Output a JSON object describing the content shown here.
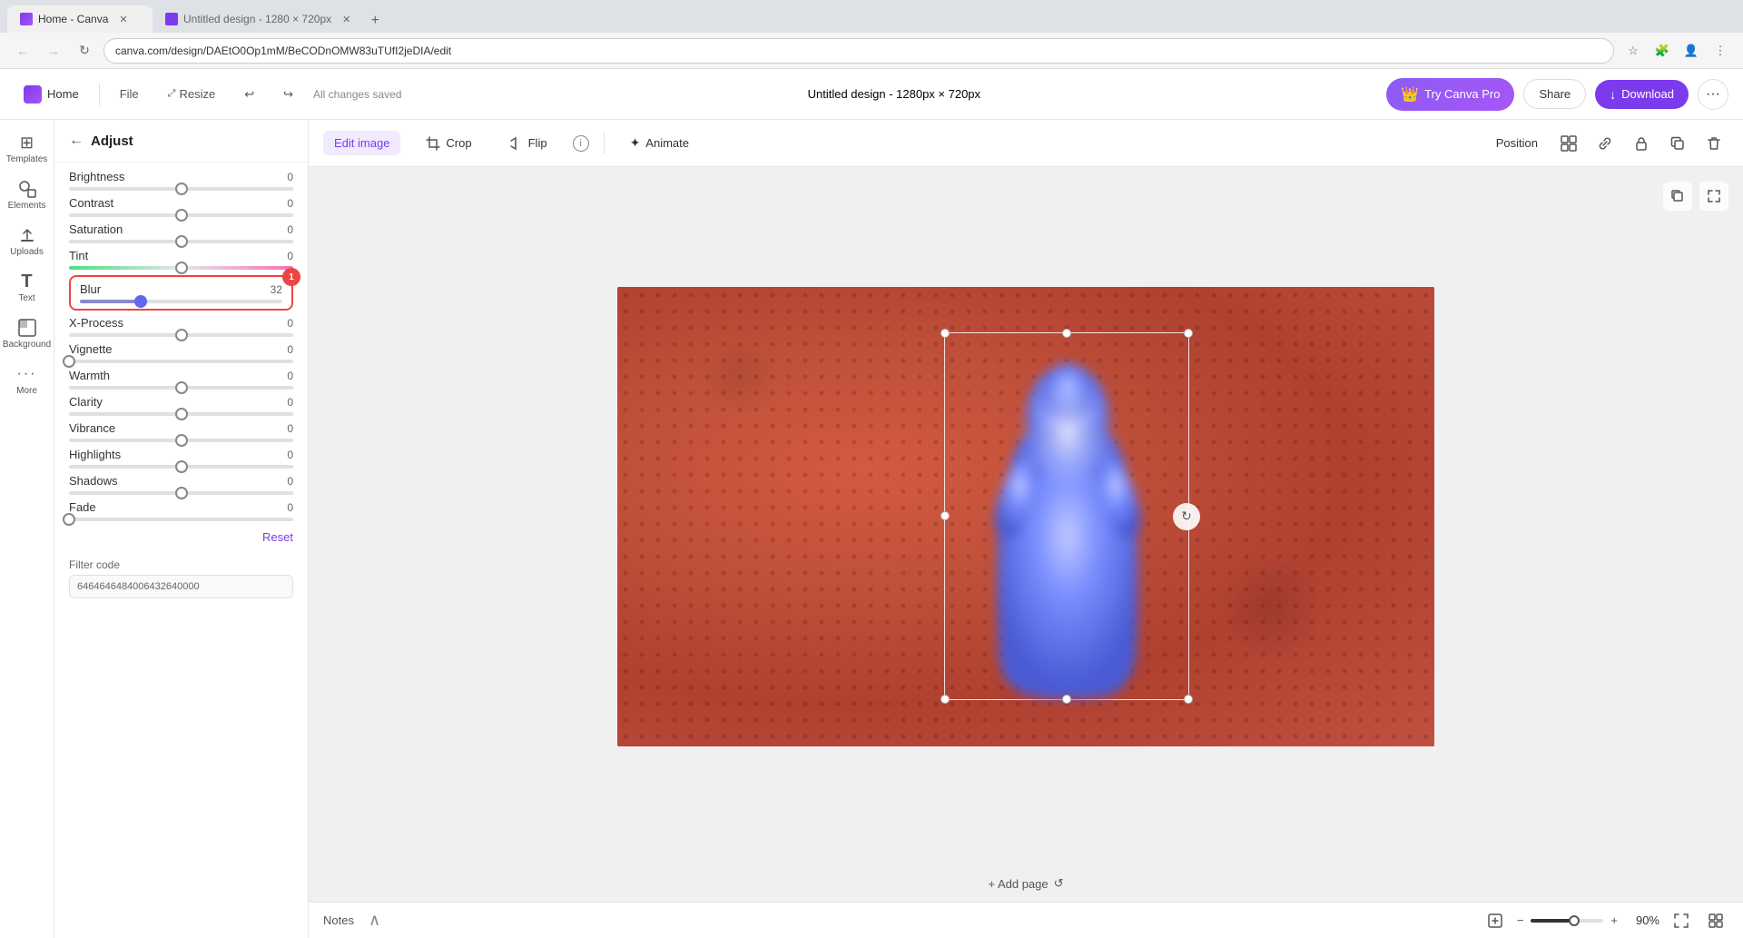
{
  "browser": {
    "tabs": [
      {
        "id": "home",
        "label": "Home - Canva",
        "active": true,
        "icon": "canva"
      },
      {
        "id": "design",
        "label": "Untitled design - 1280 × 720px",
        "active": false,
        "icon": "canva"
      }
    ],
    "address": "canva.com/design/DAEtO0Op1mM/BeCODnOMW83uTUfI2jeDIA/edit"
  },
  "topbar": {
    "home_label": "Home",
    "file_label": "File",
    "resize_label": "Resize",
    "save_status": "All changes saved",
    "design_title": "Untitled design - 1280px × 720px",
    "try_pro_label": "Try Canva Pro",
    "share_label": "Share",
    "download_label": "Download"
  },
  "sidebar_icons": [
    {
      "id": "templates",
      "label": "Templates",
      "icon": "⊞"
    },
    {
      "id": "elements",
      "label": "Elements",
      "icon": "✦"
    },
    {
      "id": "uploads",
      "label": "Uploads",
      "icon": "↑"
    },
    {
      "id": "text",
      "label": "Text",
      "icon": "T"
    },
    {
      "id": "background",
      "label": "Background",
      "icon": "▨"
    },
    {
      "id": "more",
      "label": "More",
      "icon": "···"
    }
  ],
  "adjust_panel": {
    "title": "Adjust",
    "sliders": [
      {
        "id": "brightness",
        "label": "Brightness",
        "value": 0,
        "percent": 50
      },
      {
        "id": "contrast",
        "label": "Contrast",
        "value": 0,
        "percent": 50
      },
      {
        "id": "saturation",
        "label": "Saturation",
        "value": 0,
        "percent": 50
      },
      {
        "id": "tint",
        "label": "Tint",
        "value": 0,
        "percent": 50,
        "special": "tint"
      },
      {
        "id": "blur",
        "label": "Blur",
        "value": 32,
        "percent": 30,
        "highlighted": true
      },
      {
        "id": "xprocess",
        "label": "X-Process",
        "value": 0,
        "percent": 50
      },
      {
        "id": "vignette",
        "label": "Vignette",
        "value": 0,
        "percent": 0
      },
      {
        "id": "warmth",
        "label": "Warmth",
        "value": 0,
        "percent": 50
      },
      {
        "id": "clarity",
        "label": "Clarity",
        "value": 0,
        "percent": 50
      },
      {
        "id": "vibrance",
        "label": "Vibrance",
        "value": 0,
        "percent": 50
      },
      {
        "id": "highlights",
        "label": "Highlights",
        "value": 0,
        "percent": 50
      },
      {
        "id": "shadows",
        "label": "Shadows",
        "value": 0,
        "percent": 50
      },
      {
        "id": "fade",
        "label": "Fade",
        "value": 0,
        "percent": 0
      }
    ],
    "reset_label": "Reset",
    "filter_code_label": "Filter code",
    "filter_code_value": "6464646484006432640000"
  },
  "toolbar": {
    "edit_image_label": "Edit image",
    "crop_label": "Crop",
    "flip_label": "Flip",
    "animate_label": "Animate",
    "position_label": "Position"
  },
  "canvas": {
    "add_page_label": "+ Add page"
  },
  "status_bar": {
    "notes_label": "Notes",
    "zoom_value": "90%"
  }
}
